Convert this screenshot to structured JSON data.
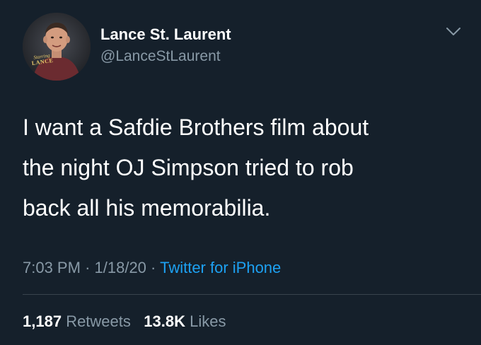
{
  "author": {
    "display_name": "Lance St. Laurent",
    "handle": "@LanceStLaurent",
    "avatar_badge_line1": "Starring",
    "avatar_badge_line2": "LANCE"
  },
  "tweet": {
    "text": "I want a Safdie Brothers film about\nthe night OJ Simpson tried to rob\nback all his memorabilia.",
    "time": "7:03 PM",
    "separator": "·",
    "date": "1/18/20",
    "source": "Twitter for iPhone"
  },
  "stats": {
    "retweets_count": "1,187",
    "retweets_label": "Retweets",
    "likes_count": "13.8K",
    "likes_label": "Likes"
  },
  "colors": {
    "background": "#15202b",
    "secondary_text": "#8899a6",
    "link": "#1da1f2",
    "divider": "#38444d"
  },
  "icons": {
    "menu": "chevron-down-icon"
  }
}
